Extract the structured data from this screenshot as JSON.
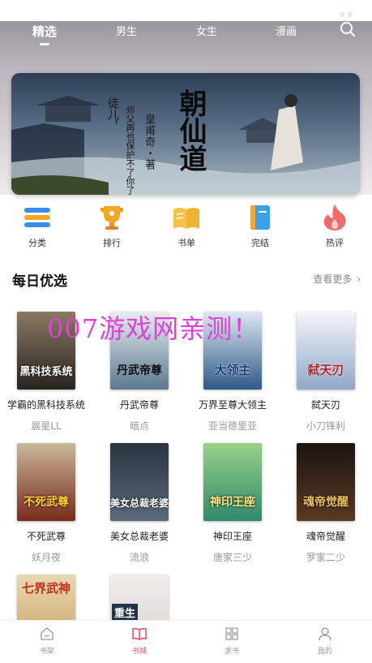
{
  "top_tabs": [
    {
      "label": "精选",
      "active": true
    },
    {
      "label": "男生",
      "active": false
    },
    {
      "label": "女生",
      "active": false
    },
    {
      "label": "漫画",
      "active": false
    }
  ],
  "banner": {
    "title": "朝仙道",
    "author": "皇甫奇・著",
    "quote_line1": "徒儿，",
    "quote_line2": "师父再也保护不了你了"
  },
  "categories": [
    {
      "label": "分类",
      "icon": "list-icon",
      "color": "#3b8ee8"
    },
    {
      "label": "排行",
      "icon": "trophy-icon",
      "color": "#f5a623"
    },
    {
      "label": "书单",
      "icon": "open-book-icon",
      "color": "#f5c24a"
    },
    {
      "label": "完结",
      "icon": "book-icon",
      "color": "#3aa0e8"
    },
    {
      "label": "热评",
      "icon": "flame-icon",
      "color": "#f26b6b"
    }
  ],
  "section": {
    "title": "每日优选",
    "more": "查看更多"
  },
  "watermark": "007游戏网亲测！",
  "books": [
    {
      "title": "学霸的黑科技系统",
      "author": "晨星LL",
      "cover_text": "黑科技系统",
      "cover_color": "#5a4a3a"
    },
    {
      "title": "丹武帝尊",
      "author": "暗点",
      "cover_text": "丹武帝尊",
      "cover_color": "#6f8ea3"
    },
    {
      "title": "万界至尊大领主",
      "author": "亚当德里亚",
      "cover_text": "大领主",
      "cover_color": "#2d5a86"
    },
    {
      "title": "弑天刃",
      "author": "小刀锋利",
      "cover_text": "弑天刃",
      "cover_color": "#8fa8c8"
    },
    {
      "title": "不死武尊",
      "author": "妖月夜",
      "cover_text": "不死武尊",
      "cover_color": "#7a2a1a"
    },
    {
      "title": "美女总裁老婆",
      "author": "流浪",
      "cover_text": "美女总裁老婆",
      "cover_color": "#3a4a5a"
    },
    {
      "title": "神印王座",
      "author": "唐家三少",
      "cover_text": "神印王座",
      "cover_color": "#2f8a6a"
    },
    {
      "title": "魂帝觉醒",
      "author": "罗家二少",
      "cover_text": "魂帝觉醒",
      "cover_color": "#3a2a22"
    },
    {
      "title": "",
      "author": "",
      "cover_text": "七界武神",
      "cover_color": "#c8a060"
    },
    {
      "title": "",
      "author": "",
      "cover_text": "重生",
      "cover_color": "#d8d0cc"
    }
  ],
  "bottom_tabs": [
    {
      "label": "书架",
      "icon": "home-icon",
      "active": false
    },
    {
      "label": "书城",
      "icon": "open-book-icon",
      "active": true
    },
    {
      "label": "求书",
      "icon": "grid-icon",
      "active": false
    },
    {
      "label": "我的",
      "icon": "person-icon",
      "active": false
    }
  ],
  "colors": {
    "accent": "#e8466a",
    "watermark": "#e040d8"
  }
}
